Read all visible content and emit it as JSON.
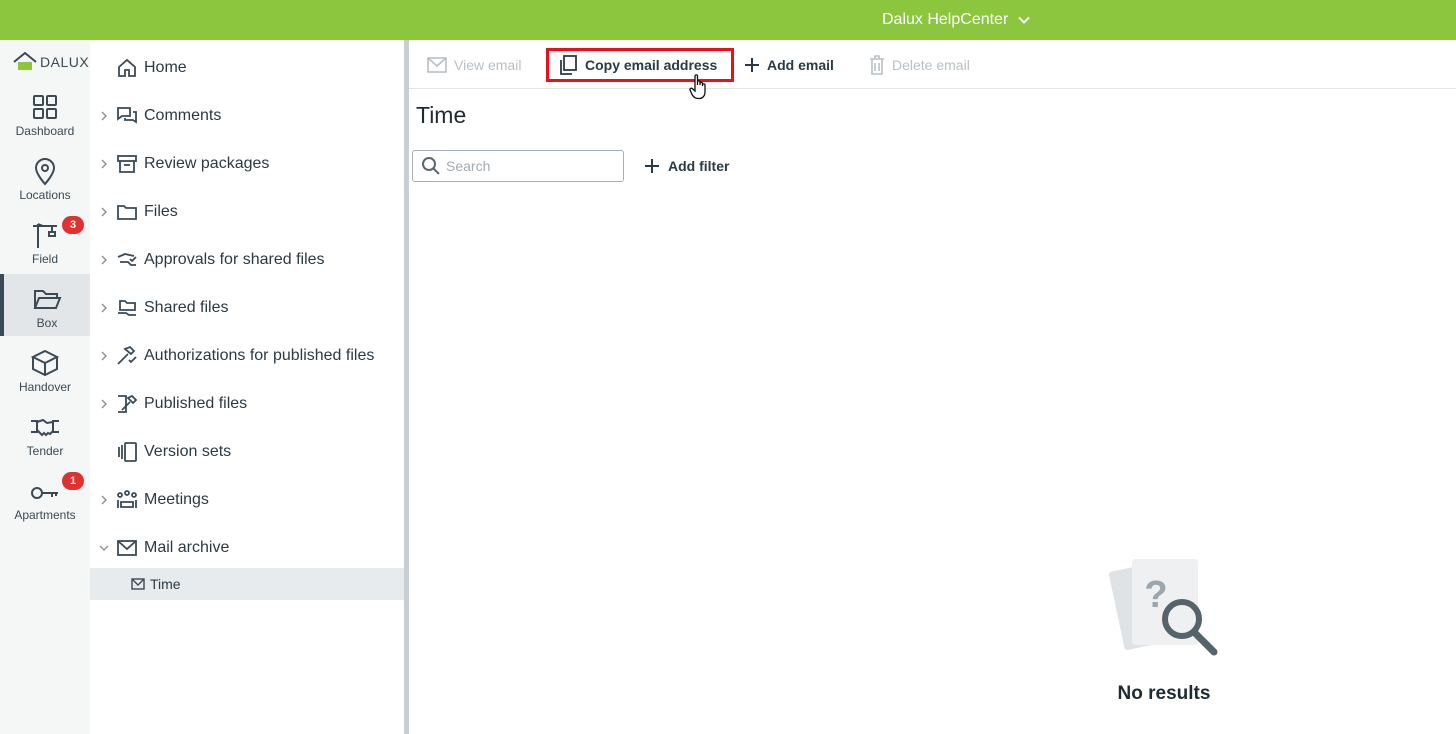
{
  "topbar": {
    "help_label": "Dalux HelpCenter",
    "color": "#8cc63f"
  },
  "rail": {
    "logo_text": "DALUX",
    "items": [
      {
        "label": "Dashboard",
        "icon": "grid-icon"
      },
      {
        "label": "Locations",
        "icon": "map-pin-icon"
      },
      {
        "label": "Field",
        "icon": "crane-icon",
        "badge": "3"
      },
      {
        "label": "Box",
        "icon": "folder-open-icon",
        "active": true
      },
      {
        "label": "Handover",
        "icon": "box-icon"
      },
      {
        "label": "Tender",
        "icon": "handshake-icon"
      },
      {
        "label": "Apartments",
        "icon": "key-icon",
        "badge": "1"
      }
    ]
  },
  "tree": {
    "items": [
      {
        "label": "Home",
        "icon": "home-icon",
        "expandable": false
      },
      {
        "label": "Comments",
        "icon": "comments-icon",
        "expandable": true
      },
      {
        "label": "Review packages",
        "icon": "archive-icon",
        "expandable": true
      },
      {
        "label": "Files",
        "icon": "folder-icon",
        "expandable": true
      },
      {
        "label": "Approvals for shared files",
        "icon": "hand-check-icon",
        "expandable": true
      },
      {
        "label": "Shared files",
        "icon": "hand-folder-icon",
        "expandable": true
      },
      {
        "label": "Authorizations for published files",
        "icon": "hammer-check-icon",
        "expandable": true
      },
      {
        "label": "Published files",
        "icon": "hammer-icon",
        "expandable": true
      },
      {
        "label": "Version sets",
        "icon": "version-sets-icon",
        "expandable": false
      },
      {
        "label": "Meetings",
        "icon": "meeting-icon",
        "expandable": true
      },
      {
        "label": "Mail archive",
        "icon": "mail-icon",
        "expandable": true,
        "expanded": true
      }
    ],
    "selected_child": {
      "label": "Time",
      "icon": "mail-icon"
    }
  },
  "toolbar": {
    "view_email": "View email",
    "copy_email": "Copy email address",
    "add_email": "Add email",
    "delete_email": "Delete email",
    "highlight_color": "#e8101a"
  },
  "main": {
    "title": "Time",
    "search_placeholder": "Search",
    "add_filter": "Add filter",
    "empty_text": "No results"
  }
}
